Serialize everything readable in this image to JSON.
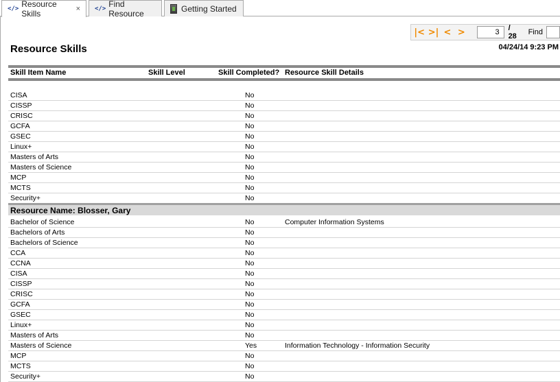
{
  "tabs": [
    {
      "label": "Resource Skills",
      "icon": "code-icon",
      "close": "×"
    },
    {
      "label": "Find Resource",
      "icon": "code-icon"
    },
    {
      "label": "Getting Started",
      "icon": "getting-started-icon"
    }
  ],
  "toolbar": {
    "first_icon": "first-page-icon",
    "last_icon": "last-page-icon",
    "prev_icon": "previous-page-icon",
    "next_icon": "next-page-icon",
    "current_page": "3",
    "total_pages": "/ 28",
    "find_label": "Find",
    "find_value": ""
  },
  "report": {
    "title": "Resource Skills",
    "date": "04/24/14 9:23 PM",
    "columns": [
      "Skill Item Name",
      "Skill Level",
      "Skill Completed?",
      "Resource Skill Details"
    ],
    "rows_top": [
      {
        "name": "CISA",
        "completed": "No",
        "details": ""
      },
      {
        "name": "CISSP",
        "completed": "No",
        "details": ""
      },
      {
        "name": "CRISC",
        "completed": "No",
        "details": ""
      },
      {
        "name": "GCFA",
        "completed": "No",
        "details": ""
      },
      {
        "name": "GSEC",
        "completed": "No",
        "details": ""
      },
      {
        "name": "Linux+",
        "completed": "No",
        "details": ""
      },
      {
        "name": "Masters of Arts",
        "completed": "No",
        "details": ""
      },
      {
        "name": "Masters of Science",
        "completed": "No",
        "details": ""
      },
      {
        "name": "MCP",
        "completed": "No",
        "details": ""
      },
      {
        "name": "MCTS",
        "completed": "No",
        "details": ""
      },
      {
        "name": "Security+",
        "completed": "No",
        "details": ""
      }
    ],
    "group_label": "Resource Name: Blosser, Gary",
    "rows_group": [
      {
        "name": "Bachelor of Science",
        "completed": "No",
        "details": "Computer Information Systems"
      },
      {
        "name": "Bachelors of Arts",
        "completed": "No",
        "details": ""
      },
      {
        "name": "Bachelors of Science",
        "completed": "No",
        "details": ""
      },
      {
        "name": "CCA",
        "completed": "No",
        "details": ""
      },
      {
        "name": "CCNA",
        "completed": "No",
        "details": ""
      },
      {
        "name": "CISA",
        "completed": "No",
        "details": ""
      },
      {
        "name": "CISSP",
        "completed": "No",
        "details": ""
      },
      {
        "name": "CRISC",
        "completed": "No",
        "details": ""
      },
      {
        "name": "GCFA",
        "completed": "No",
        "details": ""
      },
      {
        "name": "GSEC",
        "completed": "No",
        "details": ""
      },
      {
        "name": "Linux+",
        "completed": "No",
        "details": ""
      },
      {
        "name": "Masters of Arts",
        "completed": "No",
        "details": ""
      },
      {
        "name": "Masters of Science",
        "completed": "Yes",
        "details": "Information Technology - Information Security"
      },
      {
        "name": "MCP",
        "completed": "No",
        "details": ""
      },
      {
        "name": "MCTS",
        "completed": "No",
        "details": ""
      },
      {
        "name": "Security+",
        "completed": "No",
        "details": ""
      }
    ]
  }
}
